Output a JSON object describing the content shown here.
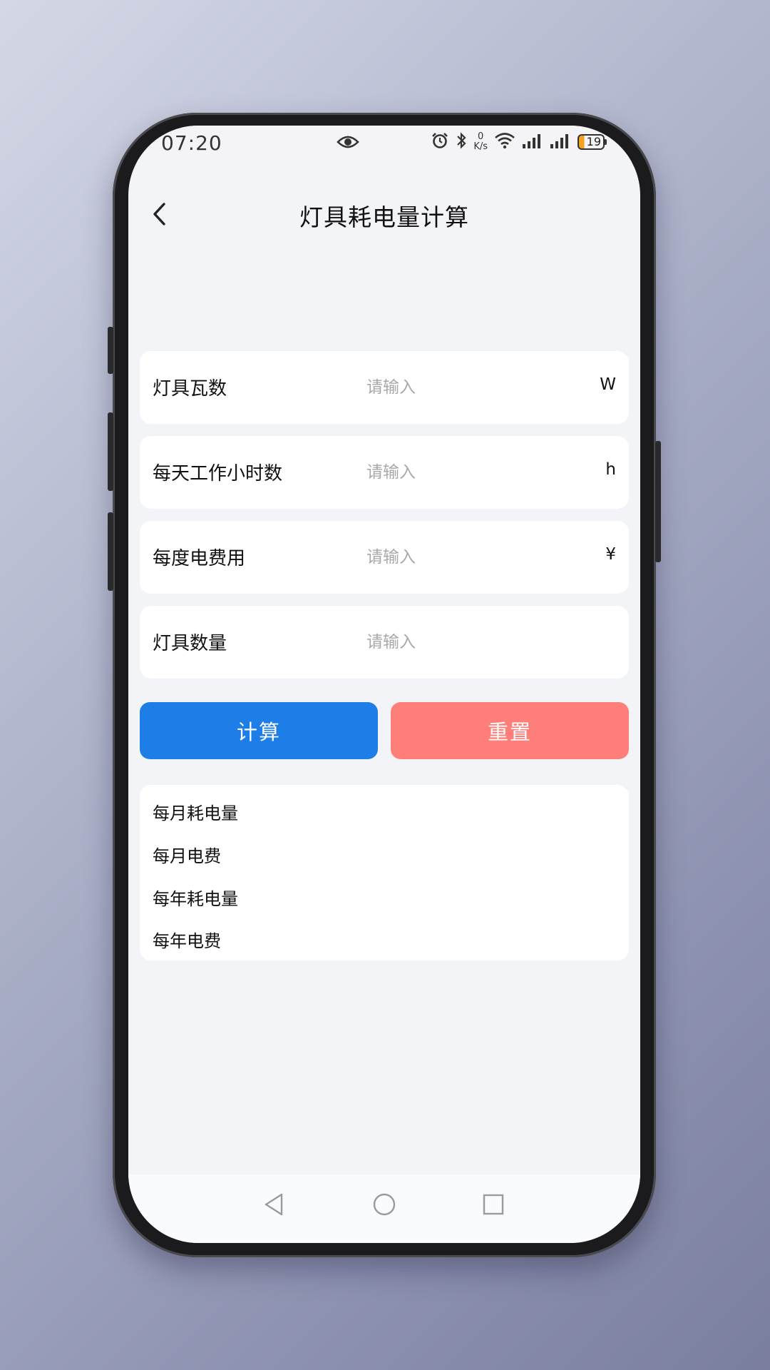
{
  "status_bar": {
    "time": "07:20",
    "net_speed_value": "0",
    "net_speed_unit": "K/s",
    "battery_level": "19",
    "icons": [
      "eye-icon",
      "alarm-icon",
      "bluetooth-icon",
      "wifi-icon",
      "signal-icon",
      "signal-icon",
      "battery-icon"
    ]
  },
  "header": {
    "title": "灯具耗电量计算",
    "back_icon": "chevron-left-icon"
  },
  "form": {
    "fields": [
      {
        "label": "灯具瓦数",
        "placeholder": "请输入",
        "value": "",
        "unit": "W"
      },
      {
        "label": "每天工作小时数",
        "placeholder": "请输入",
        "value": "",
        "unit": "h"
      },
      {
        "label": "每度电费用",
        "placeholder": "请输入",
        "value": "",
        "unit": "¥"
      },
      {
        "label": "灯具数量",
        "placeholder": "请输入",
        "value": "",
        "unit": ""
      }
    ]
  },
  "actions": {
    "calculate_label": "计算",
    "reset_label": "重置"
  },
  "results": {
    "items": [
      {
        "label": "每月耗电量"
      },
      {
        "label": "每月电费"
      },
      {
        "label": "每年耗电量"
      },
      {
        "label": "每年电费"
      }
    ]
  },
  "nav": {
    "icons": [
      "back-triangle-icon",
      "home-circle-icon",
      "recents-square-icon"
    ]
  },
  "colors": {
    "primary": "#1c7ee6",
    "reset": "#fe7f79",
    "battery_accent": "#f2a21c",
    "background": "#f3f4f7"
  }
}
